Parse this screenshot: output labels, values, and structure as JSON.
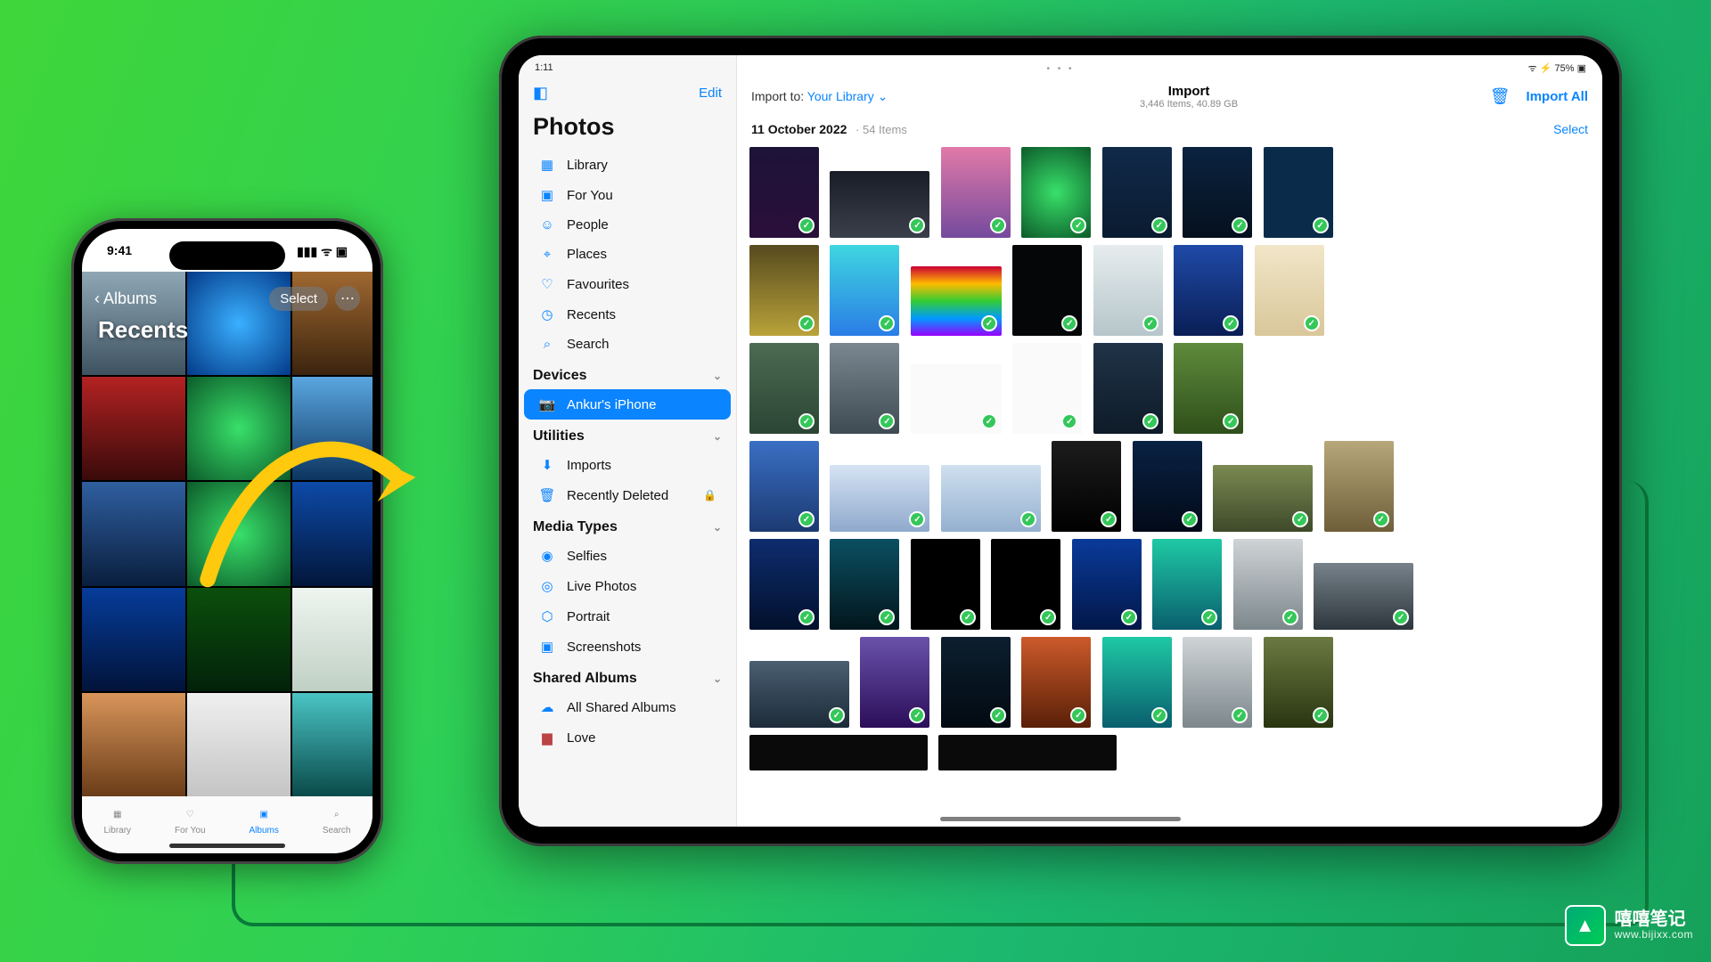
{
  "iphone": {
    "status_time": "9:41",
    "back_label": "Albums",
    "title": "Recents",
    "select_label": "Select",
    "tabs": [
      {
        "label": "Library"
      },
      {
        "label": "For You"
      },
      {
        "label": "Albums"
      },
      {
        "label": "Search"
      }
    ]
  },
  "ipad": {
    "status_time": "1:11",
    "status_battery": "75%",
    "sidebar": {
      "title": "Photos",
      "edit": "Edit",
      "items": [
        {
          "label": "Library"
        },
        {
          "label": "For You"
        },
        {
          "label": "People"
        },
        {
          "label": "Places"
        },
        {
          "label": "Favourites"
        },
        {
          "label": "Recents"
        },
        {
          "label": "Search"
        }
      ],
      "devices_header": "Devices",
      "devices": [
        {
          "label": "Ankur's iPhone"
        }
      ],
      "utilities_header": "Utilities",
      "utilities": [
        {
          "label": "Imports"
        },
        {
          "label": "Recently Deleted"
        }
      ],
      "media_header": "Media Types",
      "media": [
        {
          "label": "Selfies"
        },
        {
          "label": "Live Photos"
        },
        {
          "label": "Portrait"
        },
        {
          "label": "Screenshots"
        }
      ],
      "shared_header": "Shared Albums",
      "shared": [
        {
          "label": "All Shared Albums"
        },
        {
          "label": "Love"
        }
      ]
    },
    "main": {
      "import_to_prefix": "Import to: ",
      "import_to_value": "Your Library",
      "title": "Import",
      "subtitle": "3,446 Items, 40.89 GB",
      "import_all": "Import All",
      "date": "11 October 2022",
      "date_count": "54 Items",
      "select": "Select"
    }
  },
  "watermark": {
    "line1": "嘻嘻笔记",
    "line2": "www.bijixx.com"
  }
}
